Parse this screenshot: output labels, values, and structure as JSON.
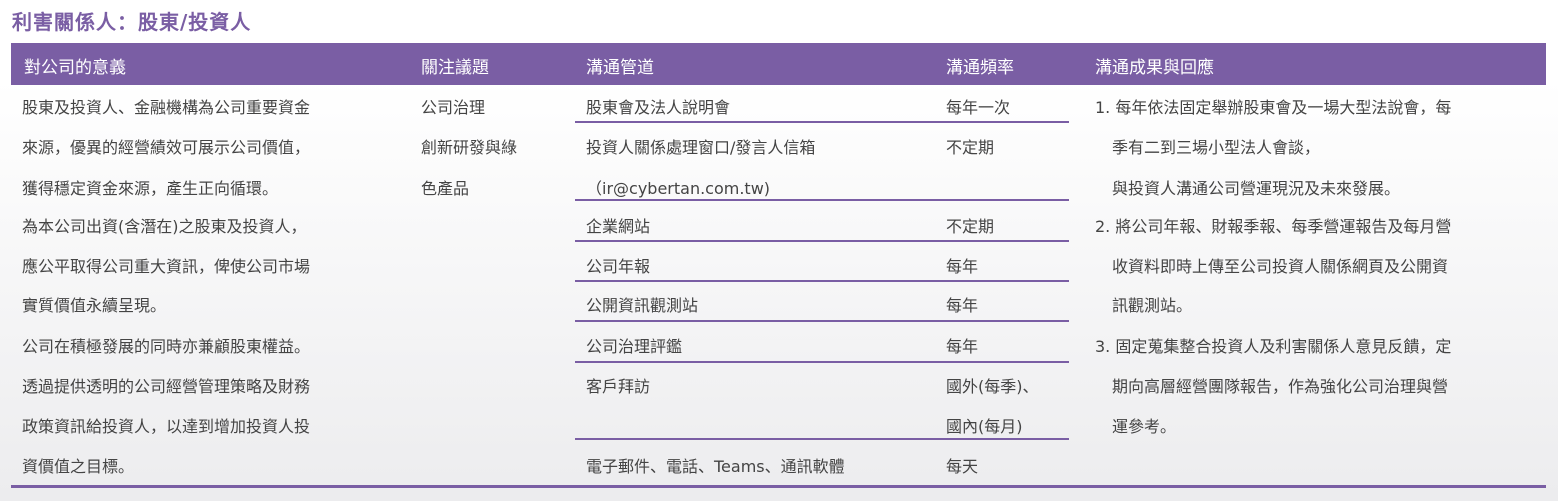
{
  "title": "利害關係人：股東/投資人",
  "headers": [
    "對公司的意義",
    "關注議題",
    "溝通管道",
    "溝通頻率",
    "溝通成果與回應"
  ],
  "significance_lines": [
    "股東及投資人、金融機構為公司重要資金",
    "來源，優異的經營績效可展示公司價值，",
    "獲得穩定資金來源，產生正向循環。",
    "為本公司出資(含潛在)之股東及投資人，",
    "應公平取得公司重大資訊，俾使公司市場",
    "實質價值永續呈現。",
    "公司在積極發展的同時亦兼顧股東權益。",
    "透過提供透明的公司經營管理策略及財務",
    "政策資訊給投資人，以達到增加投資人投",
    "資價值之目標。"
  ],
  "issue_lines": [
    "公司治理",
    "創新研發與綠",
    "色產品"
  ],
  "channels": [
    {
      "channel": [
        "股東會及法人說明會"
      ],
      "frequency": [
        "每年一次"
      ]
    },
    {
      "channel": [
        "投資人關係處理窗口/發言人信箱",
        "（ir@cybertan.com.tw)"
      ],
      "frequency": [
        "不定期"
      ]
    },
    {
      "channel": [
        "企業網站"
      ],
      "frequency": [
        "不定期"
      ]
    },
    {
      "channel": [
        "公司年報"
      ],
      "frequency": [
        "每年"
      ]
    },
    {
      "channel": [
        "公開資訊觀測站"
      ],
      "frequency": [
        "每年"
      ]
    },
    {
      "channel": [
        "公司治理評鑑"
      ],
      "frequency": [
        "每年"
      ]
    },
    {
      "channel": [
        "客戶拜訪"
      ],
      "frequency": [
        "國外(每季)、",
        "國內(每月)"
      ]
    },
    {
      "channel": [
        "電子郵件、電話、Teams、通訊軟體"
      ],
      "frequency": [
        "每天"
      ]
    }
  ],
  "results_lines": [
    "1. 每年依法固定舉辦股東會及一場大型法說會，每",
    "季有二到三場小型法人會談，",
    "與投資人溝通公司營運現況及未來發展。",
    "2. 將公司年報、財報季報、每季營運報告及每月營",
    "收資料即時上傳至公司投資人關係網頁及公開資",
    "訊觀測站。",
    "3. 固定蒐集整合投資人及利害關係人意見反饋，定",
    "期向高層經營團隊報告，作為強化公司治理與營",
    "運參考。"
  ]
}
